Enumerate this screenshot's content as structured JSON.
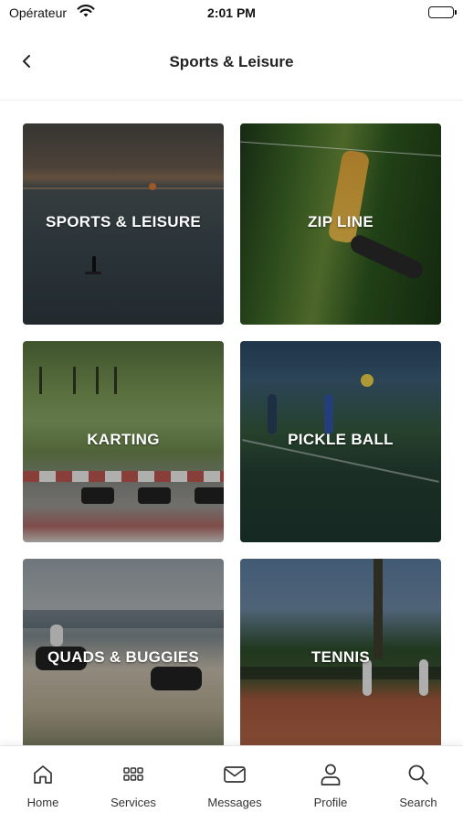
{
  "status_bar": {
    "carrier": "Opérateur",
    "time": "2:01 PM",
    "wifi_icon": "wifi-icon",
    "battery_icon": "battery-icon",
    "battery_level": 1.0
  },
  "header": {
    "back_icon": "chevron-left-icon",
    "title": "Sports & Leisure"
  },
  "tiles": [
    {
      "label": "SPORTS & LEISURE"
    },
    {
      "label": "ZIP LINE"
    },
    {
      "label": "KARTING"
    },
    {
      "label": "PICKLE BALL"
    },
    {
      "label": "QUADS & BUGGIES"
    },
    {
      "label": "TENNIS"
    }
  ],
  "tab_bar": {
    "items": [
      {
        "label": "Home",
        "icon": "home-icon"
      },
      {
        "label": "Services",
        "icon": "grid-icon"
      },
      {
        "label": "Messages",
        "icon": "envelope-icon"
      },
      {
        "label": "Profile",
        "icon": "person-icon"
      },
      {
        "label": "Search",
        "icon": "search-icon"
      }
    ]
  },
  "colors": {
    "tile_label": "#ffffff",
    "tab_label": "#333333",
    "title": "#222222"
  }
}
